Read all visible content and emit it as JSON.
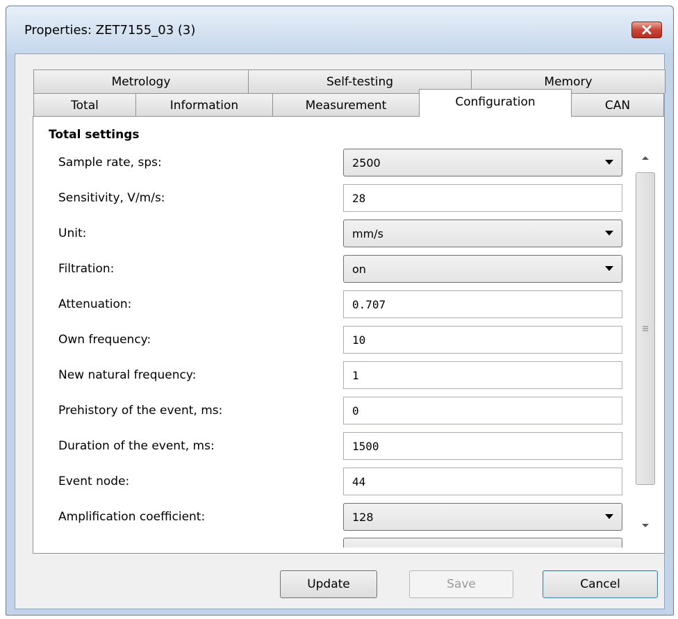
{
  "window": {
    "title": "Properties: ZET7155_03 (3)"
  },
  "tabs_top": [
    {
      "label": "Metrology"
    },
    {
      "label": "Self-testing"
    },
    {
      "label": "Memory"
    }
  ],
  "tabs_bottom": [
    {
      "label": "Total"
    },
    {
      "label": "Information"
    },
    {
      "label": "Measurement"
    },
    {
      "label": "Configuration",
      "active": true
    },
    {
      "label": "CAN"
    }
  ],
  "panel": {
    "section_title": "Total settings",
    "rows": [
      {
        "label": "Sample rate, sps:",
        "type": "combo",
        "value": "2500"
      },
      {
        "label": "Sensitivity, V/m/s:",
        "type": "text",
        "value": "28"
      },
      {
        "label": "Unit:",
        "type": "combo",
        "value": "mm/s"
      },
      {
        "label": "Filtration:",
        "type": "combo",
        "value": "on"
      },
      {
        "label": "Attenuation:",
        "type": "text",
        "value": "0.707"
      },
      {
        "label": "Own frequency:",
        "type": "text",
        "value": "10"
      },
      {
        "label": "New natural frequency:",
        "type": "text",
        "value": "1"
      },
      {
        "label": "Prehistory of the event, ms:",
        "type": "text",
        "value": "0"
      },
      {
        "label": "Duration of the event, ms:",
        "type": "text",
        "value": "1500"
      },
      {
        "label": "Event node:",
        "type": "text",
        "value": "44"
      },
      {
        "label": "Amplification coefficient:",
        "type": "combo",
        "value": "128"
      }
    ]
  },
  "buttons": {
    "update": "Update",
    "save": "Save",
    "cancel": "Cancel"
  },
  "colors": {
    "window_frame": "#c3d4e8",
    "close_button": "#c9463a",
    "cancel_focus": "#3c7fb1"
  }
}
